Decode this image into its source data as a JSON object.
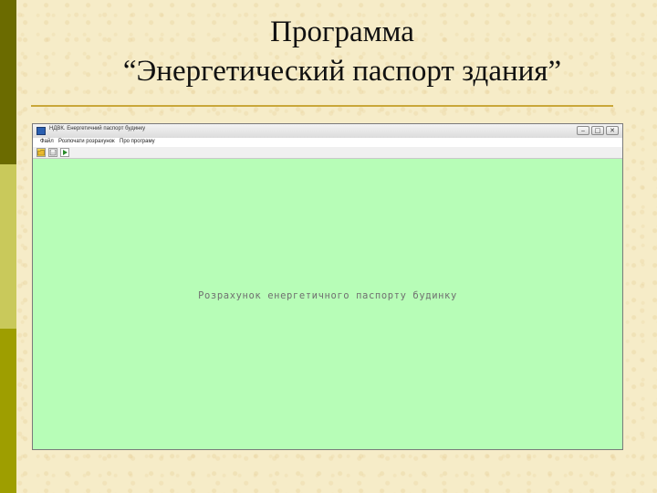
{
  "slide": {
    "title_line1": "Программа",
    "title_line2": "“Энергетический паспорт здания”",
    "accent_colors": [
      "#6b6b00",
      "#c9c95b",
      "#9e9e00"
    ],
    "rule_color": "#c9a73a"
  },
  "window": {
    "title": "НДВК. Енергетичний паспорт будинку",
    "app_icon": "app-icon",
    "controls": {
      "minimize_glyph": "‒",
      "maximize_glyph": "□",
      "close_glyph": "✕"
    }
  },
  "menu": {
    "items": [
      {
        "label": "Файл"
      },
      {
        "label": "Розпочати розрахунок"
      },
      {
        "label": "Про програму"
      }
    ]
  },
  "toolbar": {
    "buttons": [
      {
        "icon": "open-folder-icon"
      },
      {
        "icon": "save-icon"
      },
      {
        "icon": "play-icon"
      }
    ]
  },
  "canvas": {
    "background": "#b7fdb7",
    "text": "Розрахунок енергетичного паспорту будинку"
  }
}
